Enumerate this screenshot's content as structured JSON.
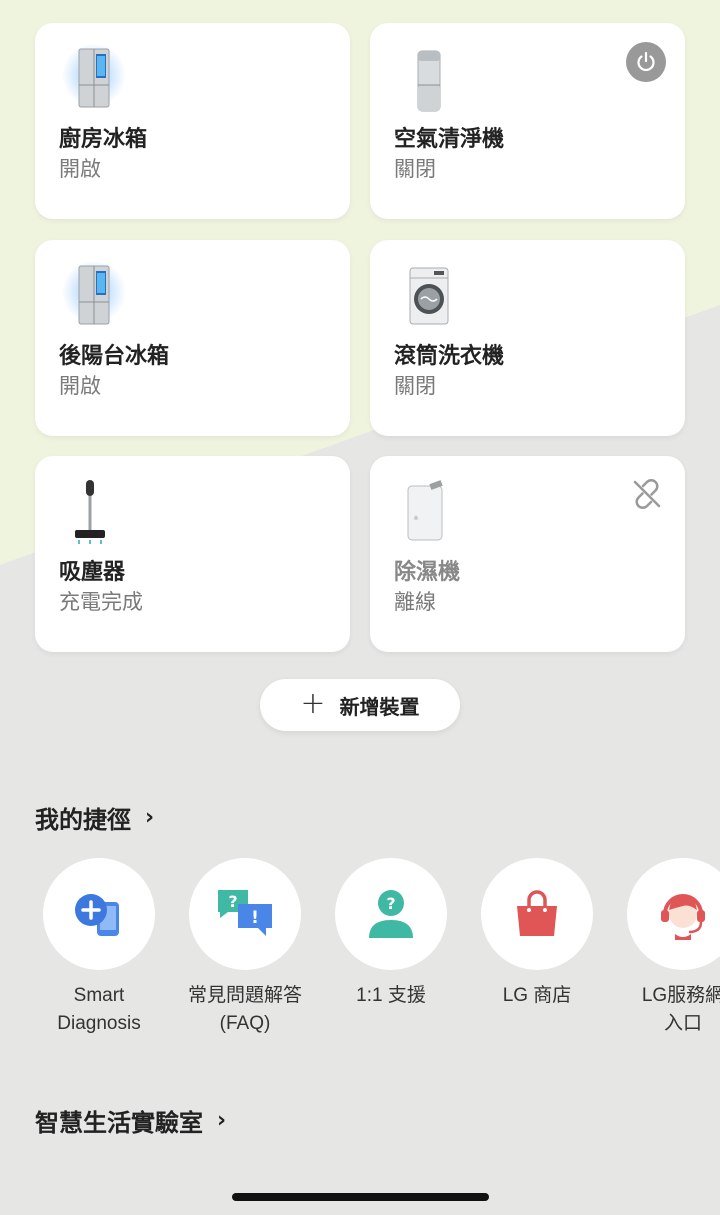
{
  "devices": [
    {
      "name": "廚房冰箱",
      "status": "開啟",
      "icon": "refrigerator-icon",
      "control": null
    },
    {
      "name": "空氣清淨機",
      "status": "關閉",
      "icon": "air-purifier-icon",
      "control": "power-icon"
    },
    {
      "name": "後陽台冰箱",
      "status": "開啟",
      "icon": "refrigerator-icon",
      "control": null
    },
    {
      "name": "滾筒洗衣機",
      "status": "關閉",
      "icon": "washing-machine-icon",
      "control": null
    },
    {
      "name": "吸塵器",
      "status": "充電完成",
      "icon": "vacuum-cleaner-icon",
      "control": null
    },
    {
      "name": "除濕機",
      "status": "離線",
      "icon": "dehumidifier-icon",
      "control": "unlink-icon"
    }
  ],
  "add_device": {
    "label": "新增裝置",
    "icon": "plus-icon"
  },
  "shortcuts": {
    "title": "我的捷徑",
    "items": [
      {
        "label": "Smart\nDiagnosis",
        "icon": "smart-diagnosis-icon"
      },
      {
        "label": "常見問題解答\n(FAQ)",
        "icon": "faq-chat-icon"
      },
      {
        "label": "1:1 支援",
        "icon": "support-person-icon"
      },
      {
        "label": "LG 商店",
        "icon": "shopping-bag-icon"
      },
      {
        "label": "LG服務網\n入口",
        "icon": "service-agent-icon"
      }
    ]
  },
  "smart_life_lab": {
    "title": "智慧生活實驗室"
  },
  "colors": {
    "background_green": "#eff4df",
    "background_gray": "#e6e6e4",
    "accent_blue": "#4a86e8",
    "faq_teal": "#3fb8a4",
    "shop_red": "#e05555"
  }
}
